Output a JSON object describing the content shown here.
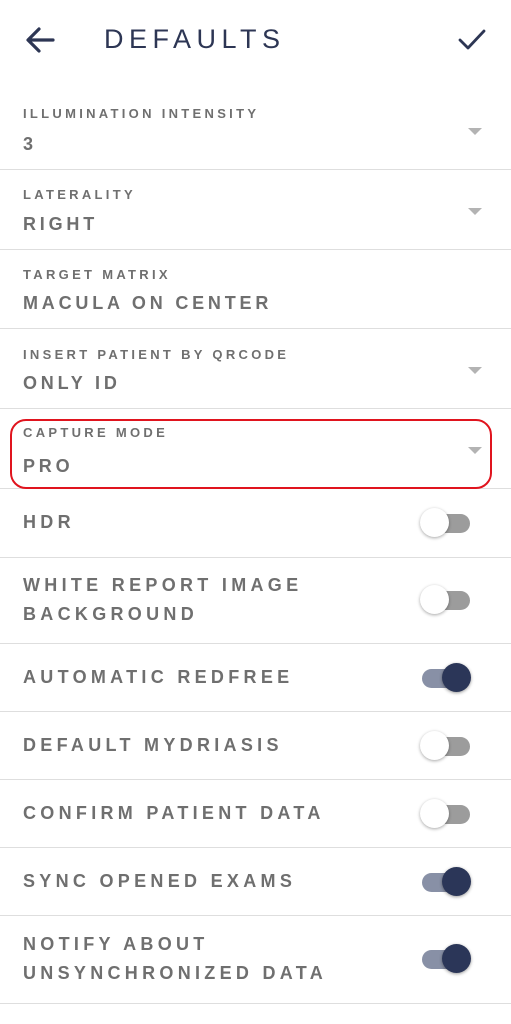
{
  "header": {
    "title": "DEFAULTS",
    "back_icon": "arrow-left-icon",
    "confirm_icon": "check-icon"
  },
  "dropdowns": [
    {
      "label": "ILLUMINATION INTENSITY",
      "value": "3"
    },
    {
      "label": "LATERALITY",
      "value": "RIGHT"
    },
    {
      "label": "TARGET MATRIX",
      "value": "MACULA ON CENTER"
    },
    {
      "label": "INSERT PATIENT BY QRCODE",
      "value": "ONLY ID"
    },
    {
      "label": "CAPTURE MODE",
      "value": "PRO"
    }
  ],
  "toggles": [
    {
      "line1": "HDR",
      "line2": "",
      "on": false
    },
    {
      "line1": "WHITE REPORT IMAGE",
      "line2": "BACKGROUND",
      "on": false
    },
    {
      "line1": "AUTOMATIC REDFREE",
      "line2": "",
      "on": true
    },
    {
      "line1": "DEFAULT MYDRIASIS",
      "line2": "",
      "on": false
    },
    {
      "line1": "CONFIRM PATIENT DATA",
      "line2": "",
      "on": false
    },
    {
      "line1": "SYNC OPENED EXAMS",
      "line2": "",
      "on": true
    },
    {
      "line1": "NOTIFY ABOUT",
      "line2": "UNSYNCHRONIZED DATA",
      "on": true
    }
  ],
  "colors": {
    "accent": "#2b3658",
    "highlight": "#e0141e",
    "text": "#6f6f6f"
  }
}
